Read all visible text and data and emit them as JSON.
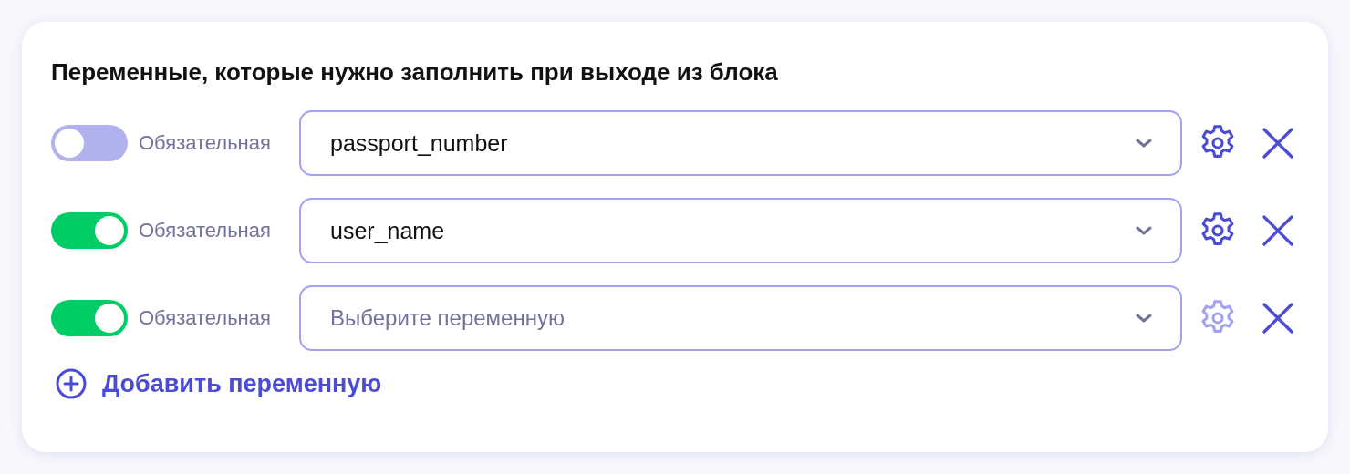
{
  "title": "Переменные, которые нужно заполнить при выходе из блока",
  "rows": [
    {
      "on": false,
      "label": "Обязательная",
      "value": "passport_number",
      "settings_disabled": false
    },
    {
      "on": true,
      "label": "Обязательная",
      "value": "user_name",
      "settings_disabled": false
    },
    {
      "on": true,
      "label": "Обязательная",
      "placeholder": "Выберите переменную",
      "settings_disabled": true
    }
  ],
  "add_button": "Добавить переменную"
}
